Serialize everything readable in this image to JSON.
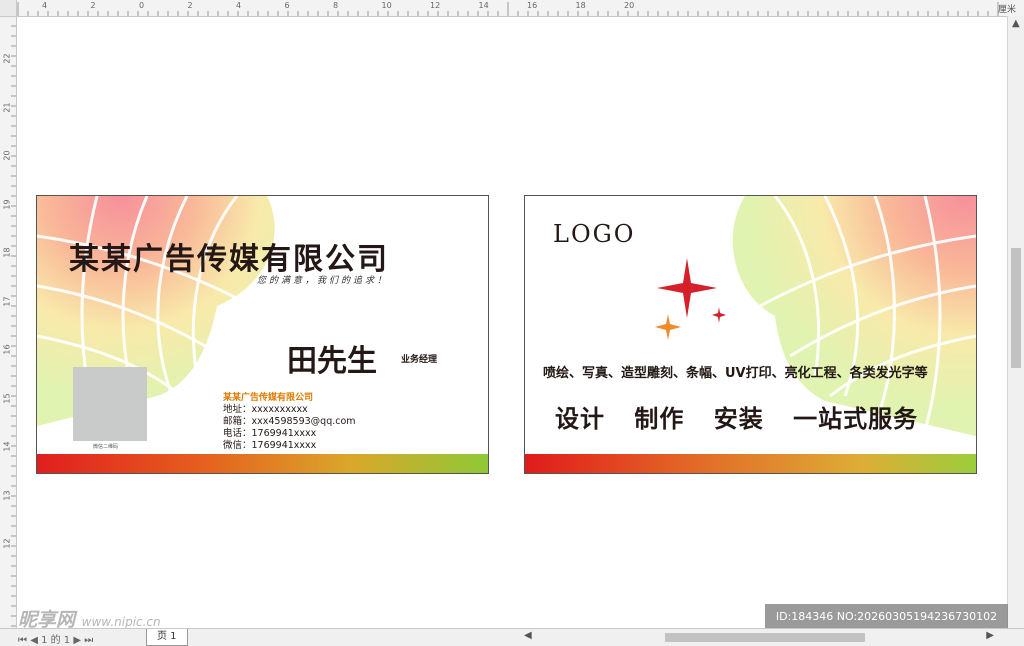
{
  "ruler": {
    "unit": "厘米",
    "top_labels": [
      "4",
      "2",
      "0",
      "2",
      "4",
      "6",
      "8",
      "10",
      "12",
      "14",
      "16",
      "18",
      "20"
    ],
    "left_labels": [
      "22",
      "21",
      "20",
      "19",
      "18",
      "17",
      "16",
      "15",
      "14",
      "13",
      "12"
    ]
  },
  "front_card": {
    "company": "某某广告传媒有限公司",
    "slogan": "您的满意，我们的追求！",
    "person": "田先生",
    "title": "业务经理",
    "qr_label": "微信二维码",
    "company_small": "某某广告传媒有限公司",
    "address": "地址：xxxxxxxxxx",
    "email": "邮箱：xxx4598593@qq.com",
    "phone": "电话：1769941xxxx",
    "wechat": "微信：1769941xxxx"
  },
  "back_card": {
    "logo": "LOGO",
    "services": "喷绘、写真、造型雕刻、条幅、UV打印、亮化工程、各类发光字等",
    "big_services": [
      "设计",
      "制作",
      "安装",
      "一站式服务"
    ]
  },
  "status_bar": {
    "page_counter": "1 的 1",
    "page_tab": "页 1"
  },
  "watermark": {
    "brand": "昵享网",
    "url": "www.nipic.cn",
    "id_text": "ID:184346 NO:20260305194236730102"
  },
  "colors": {
    "accent_orange": "#e07a00",
    "bar_red": "#e01f1f",
    "bar_green": "#8fc836"
  }
}
